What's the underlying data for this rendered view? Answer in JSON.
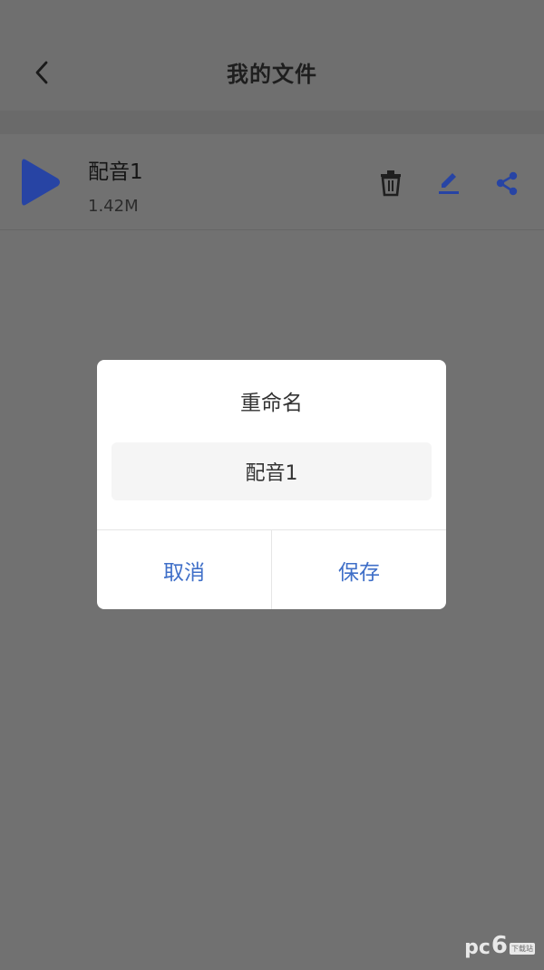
{
  "header": {
    "title": "我的文件",
    "back_icon": "chevron-left-icon"
  },
  "file": {
    "name": "配音1",
    "size": "1.42M",
    "play_icon": "play-icon",
    "actions": [
      "trash-icon",
      "edit-icon",
      "share-icon"
    ],
    "accent_color": "#2744a4"
  },
  "dialog": {
    "title": "重命名",
    "input_value": "配音1",
    "cancel_label": "取消",
    "save_label": "保存",
    "button_color": "#3f6fc8"
  },
  "watermark": {
    "brand": "pc",
    "digit": "6",
    "sub": "下载站"
  }
}
